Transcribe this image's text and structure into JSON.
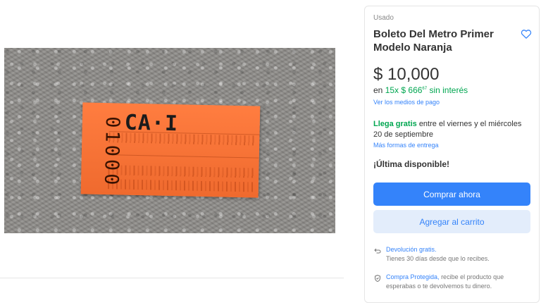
{
  "product": {
    "condition": "Usado",
    "title": "Boleto Del Metro Primer Modelo Naranja",
    "price": "$ 10,000",
    "installments": {
      "prefix": "en",
      "link": "15x $ 666",
      "cents": "67",
      "suffix": "sin interés"
    },
    "payment_link": "Ver los medios de pago",
    "shipping": {
      "free_label": "Llega gratis",
      "rest": "entre el viernes y el miércoles 20 de septiembre",
      "more_link": "Más formas de entrega"
    },
    "stock": "¡Última disponible!",
    "buy_button": "Comprar ahora",
    "cart_button": "Agregar al carrito",
    "return_policy": {
      "link": "Devolución gratis.",
      "text": "Tienes 30 días desde que lo recibes."
    },
    "protected_purchase": {
      "link": "Compra Protegida,",
      "text": "recibe el producto que esperabas o te devolvemos tu dinero."
    }
  },
  "photo": {
    "ticket_code": "CA·I",
    "ticket_serial": "01000"
  },
  "colors": {
    "accent_blue": "#3483fa",
    "success_green": "#00a650",
    "ticket_orange": "#f46f32"
  },
  "icons": {
    "favorite": "heart-icon",
    "returns": "return-icon",
    "protected": "shield-check-icon"
  }
}
